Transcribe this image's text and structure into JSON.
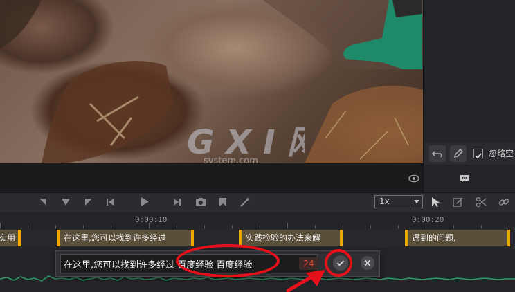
{
  "right_panel": {
    "option_label": "忽略空"
  },
  "toolbar": {
    "speed": "1x"
  },
  "ruler": {
    "labels": [
      "0:00:10",
      "0:00:20"
    ]
  },
  "subtitles": {
    "clips": [
      "实用",
      "在这里,您可以找到许多经过",
      "实践检验的办法来解",
      "遇到的问题,"
    ]
  },
  "edit_popup": {
    "text": "在这里,您可以找到许多经过  百度经验 百度经验",
    "char_count": "24"
  },
  "watermark": {
    "brand": "G X I 网",
    "url": "system.com"
  },
  "colors": {
    "subtitle_edge": "#f0a800",
    "annotation": "#e8101a",
    "count_text": "#e0432e"
  }
}
